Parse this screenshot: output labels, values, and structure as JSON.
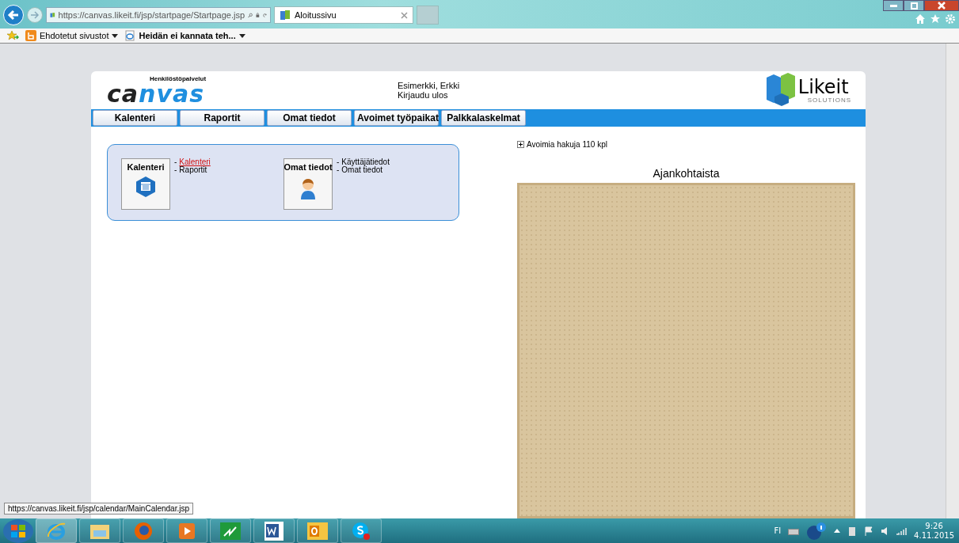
{
  "browser": {
    "url": "https://canvas.likeit.fi/jsp/startpage/Startpage.jsp",
    "tabs": [
      {
        "title": "Aloitussivu",
        "selected": true
      }
    ],
    "favorites": [
      {
        "label": "Ehdotetut sivustot",
        "bold": false
      },
      {
        "label": "Heidän ei kannata teh...",
        "bold": true
      }
    ],
    "status_link": "https://canvas.likeit.fi/jsp/calendar/MainCalendar.jsp"
  },
  "header": {
    "logo_tagline": "Henkilöstöpalvelut",
    "logo_parts": [
      {
        "text": "ca",
        "kind": "dark"
      },
      {
        "text": "nvas",
        "kind": "light"
      }
    ],
    "user_name": "Esimerkki, Erkki",
    "logout": "Kirjaudu ulos",
    "company_logo": "Likeit",
    "company_sub": "SOLUTIONS"
  },
  "nav": [
    {
      "label": "Kalenteri"
    },
    {
      "label": "Raportit"
    },
    {
      "label": "Omat tiedot"
    },
    {
      "label": "Avoimet työpaikat"
    },
    {
      "label": "Palkkalaskelmat"
    }
  ],
  "modules": [
    {
      "title": "Kalenteri",
      "kind": "calendar",
      "links": [
        {
          "bullet": "-",
          "label": "Kalenteri",
          "hover": true
        },
        {
          "bullet": "-",
          "label": "Raportit",
          "hover": false
        }
      ]
    },
    {
      "title": "Omat tiedot",
      "kind": "user",
      "links": [
        {
          "bullet": "-",
          "label": "Käyttäjätiedot",
          "hover": false
        },
        {
          "bullet": "-",
          "label": "Omat tiedot",
          "hover": false
        }
      ]
    }
  ],
  "open_jobs": {
    "label": "Avoimia hakuja 110 kpl",
    "expanded": false
  },
  "news": {
    "title": "Ajankohtaista"
  },
  "taskbar": {
    "apps": [
      {
        "kind": "ie",
        "selected": true
      },
      {
        "kind": "explorer",
        "selected": false
      },
      {
        "kind": "firefox",
        "selected": false
      },
      {
        "kind": "media",
        "selected": false
      },
      {
        "kind": "green",
        "selected": false
      },
      {
        "kind": "word",
        "selected": false
      },
      {
        "kind": "outlook",
        "selected": false
      },
      {
        "kind": "skype",
        "selected": false
      }
    ],
    "language": "FI",
    "time": "9:26",
    "date": "4.11.2015"
  }
}
